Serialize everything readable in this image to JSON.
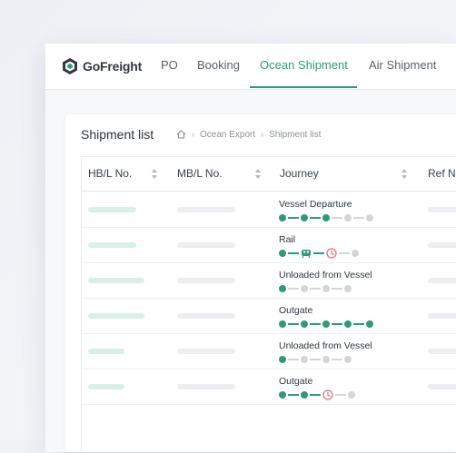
{
  "brand": {
    "name": "GoFreight",
    "primary_color": "#2e9a78",
    "alert_color": "#d9757e"
  },
  "nav": {
    "items": [
      {
        "label": "PO"
      },
      {
        "label": "Booking"
      },
      {
        "label": "Ocean Shipment"
      },
      {
        "label": "Air Shipment"
      }
    ],
    "active": "Ocean Shipment"
  },
  "page": {
    "title": "Shipment list",
    "breadcrumb": {
      "home_icon": "home-icon",
      "items": [
        "Ocean Export",
        "Shipment list"
      ]
    }
  },
  "table": {
    "columns": [
      {
        "label": "HB/L No.",
        "sortable": true
      },
      {
        "label": "MB/L No.",
        "sortable": true
      },
      {
        "label": "Journey",
        "sortable": true
      },
      {
        "label": "Ref No.",
        "sortable": false
      }
    ],
    "rows": [
      {
        "status": "Vessel Departure",
        "journey": [
          "done",
          "done",
          "done",
          "todo",
          "todo"
        ]
      },
      {
        "status": "Rail",
        "journey": [
          "done",
          "rail-icon",
          "delay-icon",
          "todo"
        ]
      },
      {
        "status": "Unloaded from Vessel",
        "journey": [
          "done",
          "todo",
          "todo",
          "todo"
        ]
      },
      {
        "status": "Outgate",
        "journey": [
          "done",
          "done",
          "done",
          "done",
          "done"
        ]
      },
      {
        "status": "Unloaded from Vessel",
        "journey": [
          "done",
          "todo",
          "todo",
          "todo"
        ]
      },
      {
        "status": "Outgate",
        "journey": [
          "done",
          "done",
          "delay-icon",
          "todo"
        ]
      }
    ]
  }
}
